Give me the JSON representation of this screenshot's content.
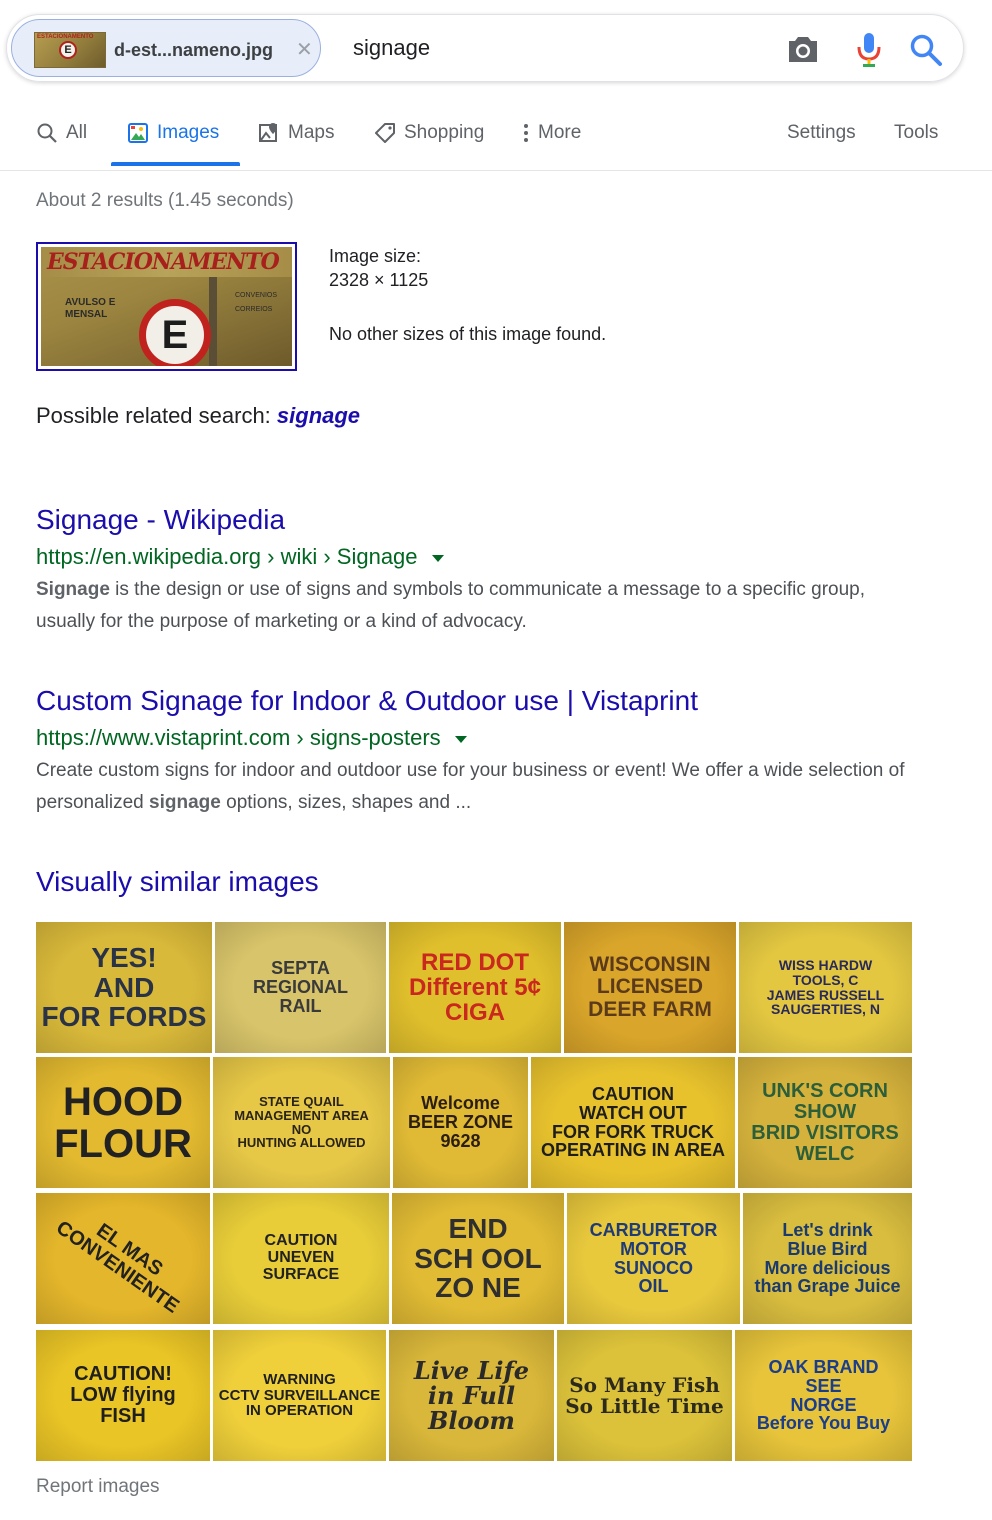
{
  "searchbar": {
    "chip_name": "d-est...nameno.jpg",
    "chip_thumb_top": "ESTACIONAMENTO",
    "chip_thumb_letter": "E",
    "chip_close": "✕",
    "query": "signage"
  },
  "tabs": [
    {
      "label": "All",
      "icon": "search-icon"
    },
    {
      "label": "Images",
      "icon": "image-icon",
      "active": true
    },
    {
      "label": "Maps",
      "icon": "map-icon"
    },
    {
      "label": "Shopping",
      "icon": "tag-icon"
    },
    {
      "label": "More",
      "icon": "more-vert-icon"
    },
    {
      "label": "Settings"
    },
    {
      "label": "Tools"
    }
  ],
  "stats": "About 2 results (1.45 seconds)",
  "query_image": {
    "title_text": "ESTACIONAMENTO",
    "left_text": "AVULSO E\nMENSAL",
    "right_text": "CONVENIOS\nCORREIOS",
    "letter": "E"
  },
  "image_info": {
    "size_label": "Image size:",
    "size_value": "2328 × 1125",
    "note": "No other sizes of this image found."
  },
  "related": {
    "prefix": "Possible related search: ",
    "term": "signage"
  },
  "results": [
    {
      "title": "Signage - Wikipedia",
      "url": "https://en.wikipedia.org › wiki › Signage",
      "snippet_bold": "Signage",
      "snippet": " is the design or use of signs and symbols to communicate a message to a specific group, usually for the purpose of marketing or a kind of advocacy."
    },
    {
      "title": "Custom Signage for Indoor & Outdoor use | Vistaprint",
      "url": "https://www.vistaprint.com › signs-posters",
      "snippet_pre": "Create custom signs for indoor and outdoor use for your business or event! We offer a wide selection of personalized ",
      "snippet_bold": "signage",
      "snippet_post": " options, sizes, shapes and ..."
    }
  ],
  "similar_title": "Visually similar images",
  "similar_images": [
    [
      {
        "text": "YES!\nAND\nFOR FORDS",
        "bg": "#d9b93a",
        "fg": "#2a3346"
      },
      {
        "text": "SEPTA\nREGIONAL\nRAIL",
        "bg": "#d8c46a",
        "fg": "#3a3a3a"
      },
      {
        "text": "RED DOT\nDifferent 5¢ CIGA",
        "bg": "#e0bf2c",
        "fg": "#c8281d"
      },
      {
        "text": "WISCONSIN\nLICENSED\nDEER FARM",
        "bg": "#d9a52a",
        "fg": "#5a3a1a"
      },
      {
        "text": "WISS HARDW\nTOOLS, C\nJAMES RUSSELL\nSAUGERTIES, N",
        "bg": "#e3c741",
        "fg": "#2a2a5a"
      }
    ],
    [
      {
        "text": "HOOD\nFLOUR",
        "bg": "#e2b92f",
        "fg": "#222222"
      },
      {
        "text": "STATE QUAIL\nMANAGEMENT AREA\nNO\nHUNTING ALLOWED",
        "bg": "#e6c746",
        "fg": "#2a2418"
      },
      {
        "text": "Welcome\nBEER ZONE\n9628",
        "bg": "#e0ba35",
        "fg": "#2b1e10"
      },
      {
        "text": "CAUTION\nWATCH OUT\nFOR FORK TRUCK\nOPERATING IN AREA",
        "bg": "#e8c22d",
        "fg": "#1e1e1e"
      },
      {
        "text": "UNK'S CORN\nSHOW\nBRID VISITORS WELC",
        "bg": "#d5b23c",
        "fg": "#2d5e3a"
      }
    ],
    [
      {
        "text": "EL MAS\nCONVENIENTE",
        "bg": "#e4b62b",
        "fg": "#222222"
      },
      {
        "text": "CAUTION\nUNEVEN\nSURFACE",
        "bg": "#e8cd38",
        "fg": "#222222"
      },
      {
        "text": "END\nSCH OOL\nZO NE",
        "bg": "#e1bb34",
        "fg": "#2f2f2f"
      },
      {
        "text": "CARBURETOR\nMOTOR\nSUNOCO\nOIL",
        "bg": "#e9c93c",
        "fg": "#1f3b77"
      },
      {
        "text": "Let's drink\nBlue Bird\nMore delicious than Grape Juice",
        "bg": "#d9bd3f",
        "fg": "#1b3a6e"
      }
    ],
    [
      {
        "text": "CAUTION!\nLOW flying\nFISH",
        "bg": "#eac526",
        "fg": "#1f1f1f"
      },
      {
        "text": "WARNING\nCCTV SURVEILLANCE\nIN OPERATION",
        "bg": "#f0d03a",
        "fg": "#1f1f1f"
      },
      {
        "text": "Live Life\nin Full\nBloom",
        "bg": "#d9b73a",
        "fg": "#2a2a2a"
      },
      {
        "text": "So Many Fish\nSo Little Time",
        "bg": "#dcc23a",
        "fg": "#2c2a1c"
      },
      {
        "text": "OAK BRAND\nSEE\nNORGE\nBefore You Buy",
        "bg": "#e7c43a",
        "fg": "#1b3d8a"
      }
    ]
  ],
  "report": "Report images",
  "colors": {
    "link": "#1a0dab",
    "url_green": "#006621",
    "accent_blue": "#1a73e8",
    "muted": "#70757a"
  }
}
